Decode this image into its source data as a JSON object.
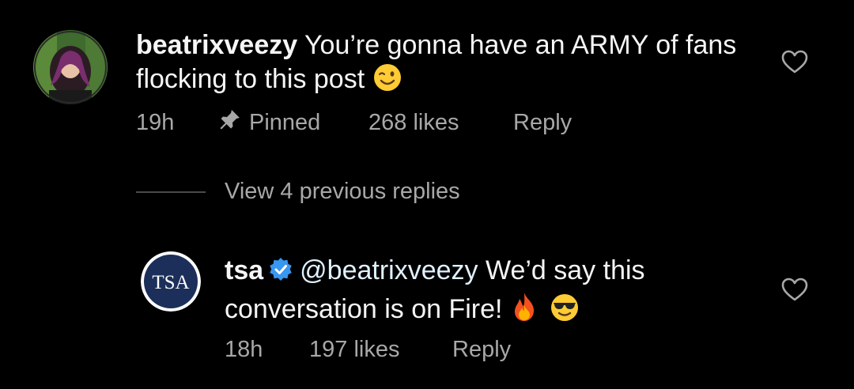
{
  "comment": {
    "username": "beatrixveezy",
    "text": " You’re gonna have an ARMY of fans flocking to this post ",
    "emoji": "wink-emoji",
    "time": "19h",
    "pinned_label": "Pinned",
    "likes": "268 likes",
    "reply_label": "Reply"
  },
  "replies_toggle": {
    "label": "View 4 previous replies"
  },
  "reply": {
    "avatar_text": "TSA",
    "username": "tsa",
    "verified": true,
    "mention": "@beatrixveezy",
    "text_line1": " We’d say this",
    "text_line2": "conversation is on Fire! ",
    "emojis": [
      "fire-emoji",
      "sunglasses-emoji"
    ],
    "time": "18h",
    "likes": "197 likes",
    "reply_label": "Reply"
  },
  "colors": {
    "background": "#000000",
    "primary_text": "#f5f5f5",
    "secondary_text": "#a8a8a8",
    "verified_blue": "#3897f0",
    "tsa_navy": "#1c2f5a"
  }
}
